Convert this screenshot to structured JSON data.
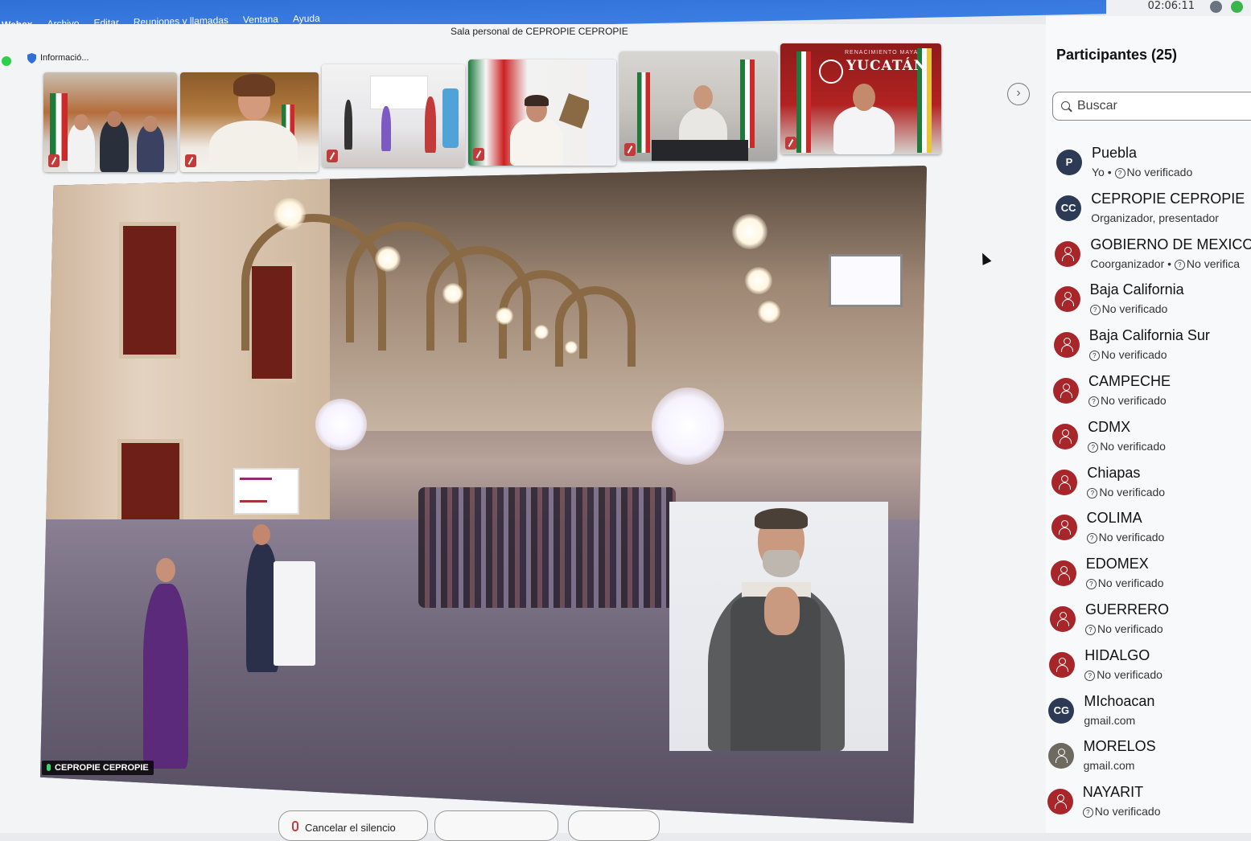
{
  "menubar": {
    "items": [
      "Webex",
      "Archivo",
      "Editar",
      "Reuniones y llamadas",
      "Ventana",
      "Ayuda"
    ],
    "clock": "02:06:11"
  },
  "window": {
    "title": "Sala personal de CEPROPIE CEPROPIE",
    "info_label": "Informació..."
  },
  "thumbnails": [
    {
      "name": "participant-video-1"
    },
    {
      "name": "participant-video-2"
    },
    {
      "name": "participant-video-3"
    },
    {
      "name": "participant-video-4"
    },
    {
      "name": "participant-video-5"
    },
    {
      "name": "participant-video-yucatan",
      "banner": "YUCATÁN",
      "banner_top": "RENACIMIENTO MAYA"
    }
  ],
  "stage": {
    "speaker_label": "CEPROPIE CEPROPIE"
  },
  "toolbar": {
    "unmute_label": "Cancelar el silencio"
  },
  "participants_panel": {
    "title": "Participantes (25)",
    "search_placeholder": "Buscar",
    "items": [
      {
        "name": "Puebla",
        "sub": "Yo • ",
        "sub2": "No verificado",
        "avatar": "P",
        "color": "#2c3a55",
        "verified_icon": true
      },
      {
        "name": "CEPROPIE CEPROPIE",
        "sub": "Organizador, presentador",
        "sub2": "",
        "avatar": "CC",
        "color": "#2c3a55",
        "verified_icon": false
      },
      {
        "name": "GOBIERNO DE MEXICO",
        "sub": "Coorganizador • ",
        "sub2": "No verifica",
        "avatar": "",
        "color": "#a8262a",
        "verified_icon": true
      },
      {
        "name": "Baja California",
        "sub": "",
        "sub2": "No verificado",
        "avatar": "",
        "color": "#a8262a",
        "verified_icon": true
      },
      {
        "name": "Baja California Sur",
        "sub": "",
        "sub2": "No verificado",
        "avatar": "",
        "color": "#a8262a",
        "verified_icon": true
      },
      {
        "name": "CAMPECHE",
        "sub": "",
        "sub2": "No verificado",
        "avatar": "",
        "color": "#a8262a",
        "verified_icon": true
      },
      {
        "name": "CDMX",
        "sub": "",
        "sub2": "No verificado",
        "avatar": "",
        "color": "#a8262a",
        "verified_icon": true
      },
      {
        "name": "Chiapas",
        "sub": "",
        "sub2": "No verificado",
        "avatar": "",
        "color": "#a8262a",
        "verified_icon": true
      },
      {
        "name": "COLIMA",
        "sub": "",
        "sub2": "No verificado",
        "avatar": "",
        "color": "#a8262a",
        "verified_icon": true
      },
      {
        "name": "EDOMEX",
        "sub": "",
        "sub2": "No verificado",
        "avatar": "",
        "color": "#a8262a",
        "verified_icon": true
      },
      {
        "name": "GUERRERO",
        "sub": "",
        "sub2": "No verificado",
        "avatar": "",
        "color": "#a8262a",
        "verified_icon": true
      },
      {
        "name": "HIDALGO",
        "sub": "",
        "sub2": "No verificado",
        "avatar": "",
        "color": "#a8262a",
        "verified_icon": true
      },
      {
        "name": "MIchoacan",
        "sub": "gmail.com",
        "sub2": "",
        "avatar": "CG",
        "color": "#2c3a55",
        "verified_icon": false
      },
      {
        "name": "MORELOS",
        "sub": "gmail.com",
        "sub2": "",
        "avatar": "",
        "color": "#6f6a60",
        "verified_icon": false
      },
      {
        "name": "NAYARIT",
        "sub": "",
        "sub2": "No verificado",
        "avatar": "",
        "color": "#a8262a",
        "verified_icon": true
      }
    ]
  },
  "colors": {
    "menubar_blue": "#3b7ee3",
    "status_green": "#2bd14a",
    "guest_red": "#a8262a",
    "avatar_navy": "#2c3a55"
  }
}
